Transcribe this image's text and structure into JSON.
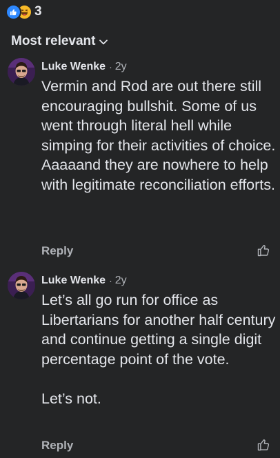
{
  "reactions": {
    "count": "3",
    "icons": [
      "like-icon",
      "haha-icon"
    ],
    "colors": {
      "like": "#2d88ff",
      "haha": "#f7b928"
    }
  },
  "sort": {
    "label": "Most relevant",
    "icon": "chevron-down-icon"
  },
  "comments": [
    {
      "author": "Luke Wenke",
      "separator": "·",
      "age": "2y",
      "text": "Vermin and Rod are out there still encouraging bullshit. Some of us went through literal hell while simping for their activities of choice.  Aaaaand they are nowhere to help with legitimate reconciliation efforts.",
      "reply_label": "Reply",
      "like_icon": "thumbs-up-icon"
    },
    {
      "author": "Luke Wenke",
      "separator": "·",
      "age": "2y",
      "text": "Let’s all go run for office as Libertarians for another half century and continue getting a single digit percentage point of the vote.\n\nLet’s not.",
      "reply_label": "Reply",
      "like_icon": "thumbs-up-icon"
    }
  ]
}
